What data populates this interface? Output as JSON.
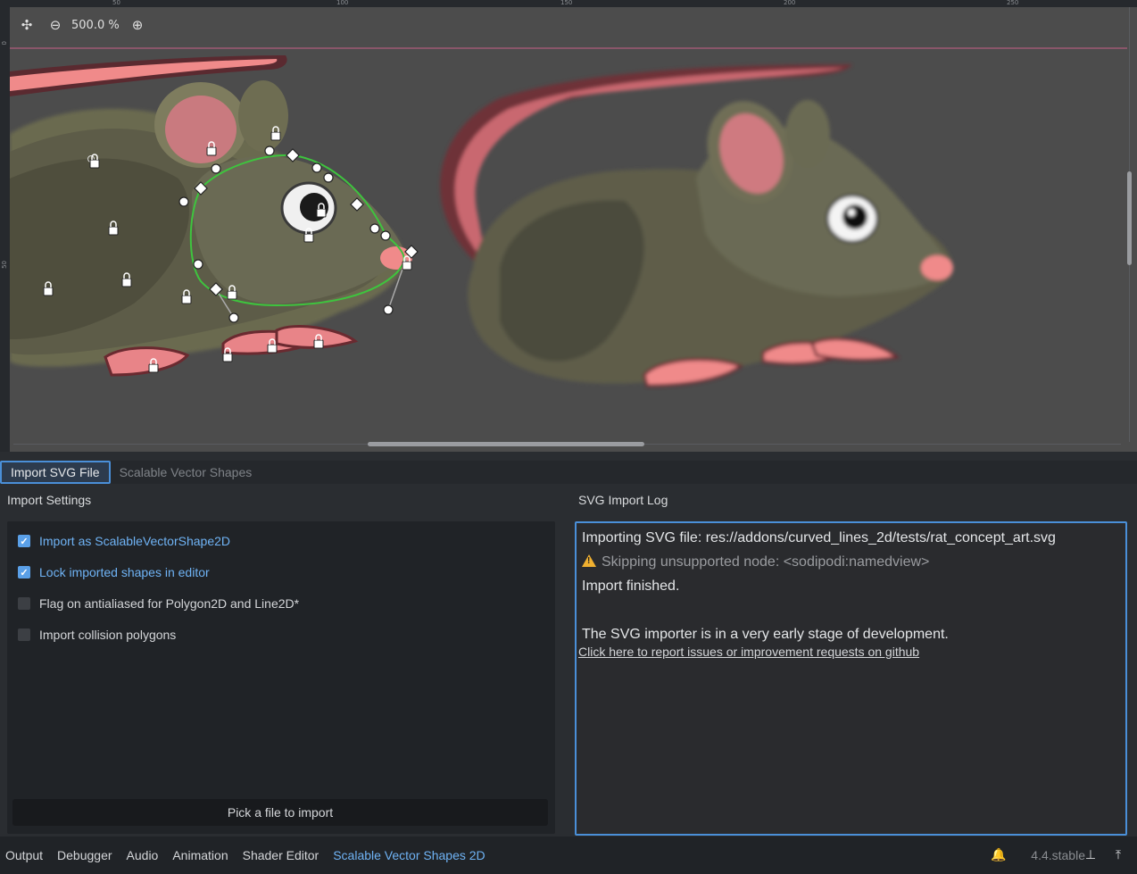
{
  "viewport": {
    "zoom_label": "500.0 %",
    "ruler_top_ticks": [
      "50",
      "100",
      "150",
      "200",
      "250"
    ],
    "ruler_left_ticks": [
      "0",
      "50"
    ]
  },
  "tabs": [
    {
      "label": "Import SVG File",
      "active": true
    },
    {
      "label": "Scalable Vector Shapes",
      "active": false
    }
  ],
  "import_settings": {
    "title": "Import Settings",
    "options": [
      {
        "label": "Import as ScalableVectorShape2D",
        "checked": true
      },
      {
        "label": "Lock imported shapes in editor",
        "checked": true
      },
      {
        "label": "Flag on antialiased for Polygon2D and Line2D*",
        "checked": false
      },
      {
        "label": "Import collision polygons",
        "checked": false
      }
    ],
    "pick_button": "Pick a file to import"
  },
  "log": {
    "title": "SVG Import Log",
    "line1": "Importing SVG file: res://addons/curved_lines_2d/tests/rat_concept_art.svg",
    "warning": "Skipping  unsupported node: <sodipodi:namedview>",
    "line3": "Import finished.",
    "line4": "The SVG importer is in a very early stage of development.",
    "link": "Click here to report issues or improvement requests on github"
  },
  "bottom_bar": {
    "items": [
      "Output",
      "Debugger",
      "Audio",
      "Animation",
      "Shader Editor",
      "Scalable Vector Shapes 2D"
    ],
    "active": "Scalable Vector Shapes 2D",
    "version": "4.4.stable"
  },
  "icons": [
    "center-view-icon",
    "zoom-out-icon",
    "zoom-in-icon",
    "lock-icon",
    "warning-icon",
    "bell-icon",
    "pin-icon",
    "expand-icon"
  ]
}
